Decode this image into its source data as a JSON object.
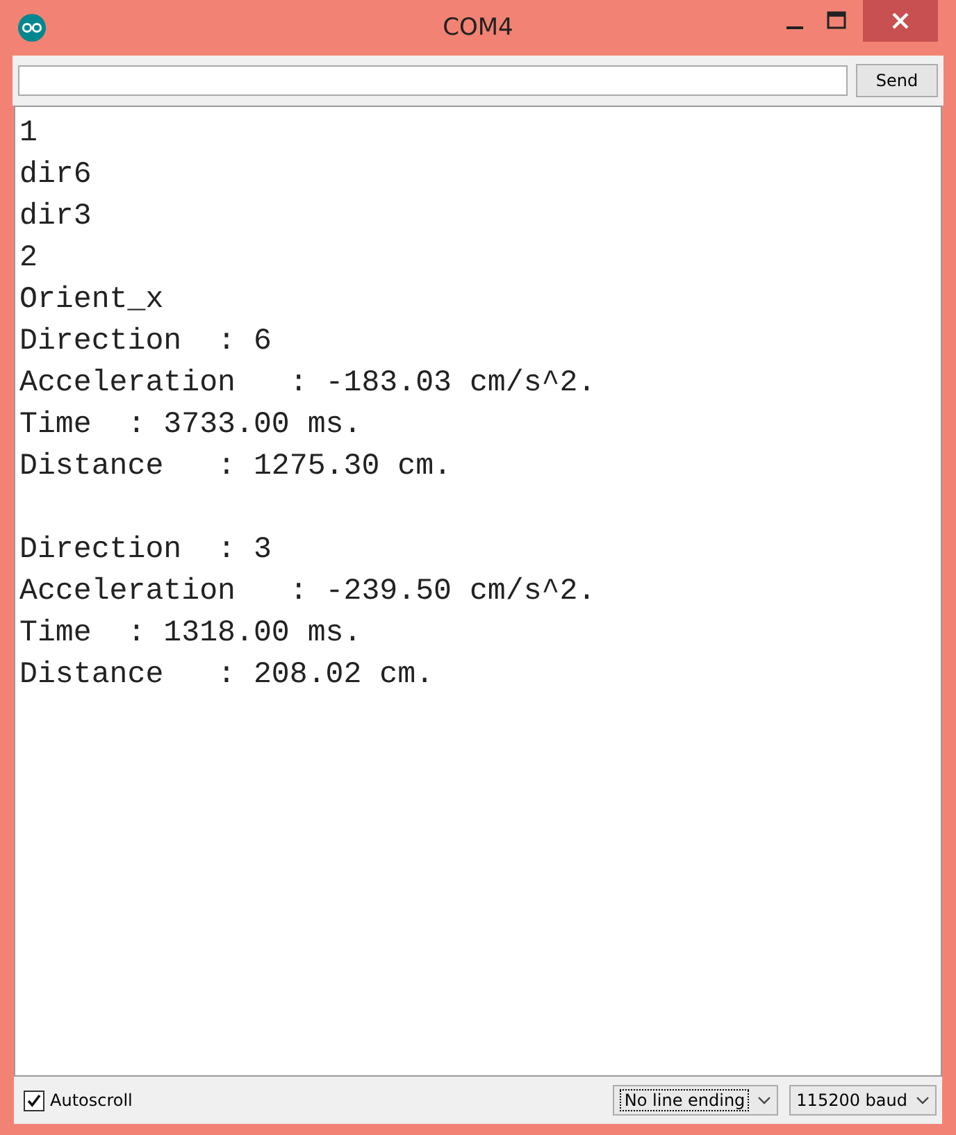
{
  "window": {
    "title": "COM4"
  },
  "send_button": {
    "label": "Send"
  },
  "output": [
    {
      "kind": "text",
      "text": "1"
    },
    {
      "kind": "text",
      "text": "dir6"
    },
    {
      "kind": "text",
      "text": "dir3"
    },
    {
      "kind": "text",
      "text": "2"
    },
    {
      "kind": "text",
      "text": "Orient_x"
    },
    {
      "kind": "text",
      "text": "Direction  : 6"
    },
    {
      "kind": "text",
      "text": "Acceleration   : -183.03 cm/s^2."
    },
    {
      "kind": "text",
      "text": "Time  : 3733.00 ms."
    },
    {
      "kind": "text",
      "text": "Distance   : 1275.30 cm."
    },
    {
      "kind": "blank"
    },
    {
      "kind": "text",
      "text": "Direction  : 3"
    },
    {
      "kind": "text",
      "text": "Acceleration   : -239.50 cm/s^2."
    },
    {
      "kind": "text",
      "text": "Time  : 1318.00 ms."
    },
    {
      "kind": "text",
      "text": "Distance   : 208.02 cm."
    }
  ],
  "status_bar": {
    "autoscroll": {
      "label": "Autoscroll",
      "checked": true
    },
    "line_ending": {
      "value": "No line ending"
    },
    "baud": {
      "value": "115200 baud"
    }
  }
}
